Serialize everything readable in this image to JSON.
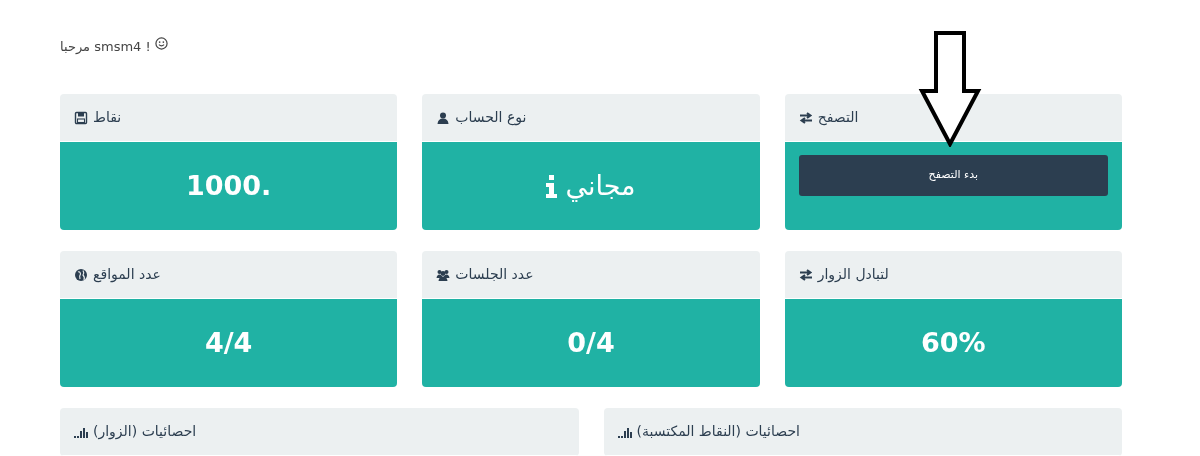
{
  "greeting": "مرحبا smsm4 !",
  "cards": [
    {
      "title": "التصفح",
      "kind": "button",
      "button": "بدء التصفح"
    },
    {
      "title": "نوع الحساب",
      "kind": "value",
      "value": "مجاني"
    },
    {
      "title": "نقاط",
      "kind": "value",
      "value": "1000."
    },
    {
      "title": "لتبادل الزوار",
      "kind": "value",
      "value": "60%"
    },
    {
      "title": "عدد الجلسات",
      "kind": "value",
      "value": "0/4"
    },
    {
      "title": "عدد المواقع",
      "kind": "value",
      "value": "4/4"
    }
  ],
  "stats": [
    {
      "title": "احصائيات (النقاط المكتسبة)"
    },
    {
      "title": "احصائيات (الزوار)"
    }
  ]
}
